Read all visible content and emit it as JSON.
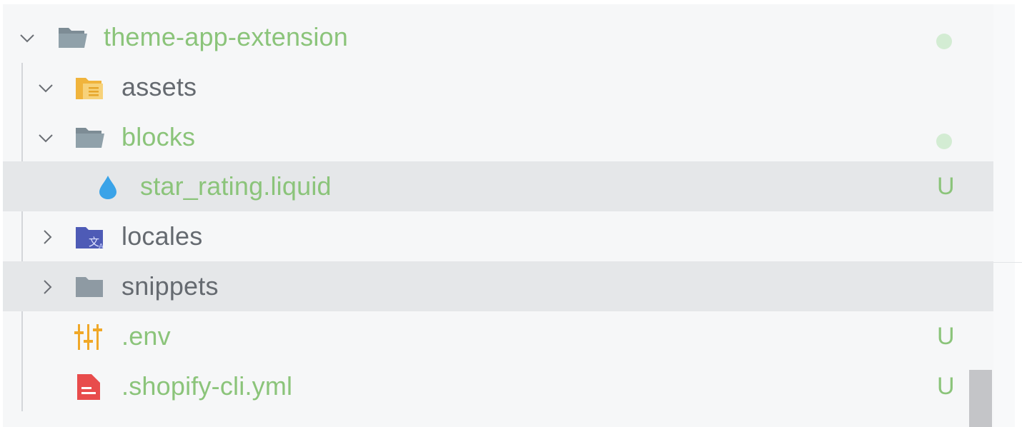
{
  "tree": {
    "root": {
      "label": "theme-app-extension",
      "icon": "folder-open-icon",
      "status": "dot"
    },
    "items": [
      {
        "label": "assets",
        "icon": "assets-folder-icon",
        "expanded": true
      },
      {
        "label": "blocks",
        "icon": "folder-open-icon",
        "expanded": true,
        "status": "dot"
      },
      {
        "label": "star_rating.liquid",
        "icon": "liquid-drop-icon",
        "badge": "U"
      },
      {
        "label": "locales",
        "icon": "locales-folder-icon",
        "expanded": false
      },
      {
        "label": "snippets",
        "icon": "folder-icon",
        "expanded": false
      },
      {
        "label": ".env",
        "icon": "env-sliders-icon",
        "badge": "U"
      },
      {
        "label": ".shopify-cli.yml",
        "icon": "yml-file-icon",
        "badge": "U"
      }
    ]
  },
  "colors": {
    "untracked_text": "#8bc47a",
    "normal_text": "#656a70",
    "selected_row": "#e5e7e9",
    "status_dot": "#d3ecd3"
  }
}
